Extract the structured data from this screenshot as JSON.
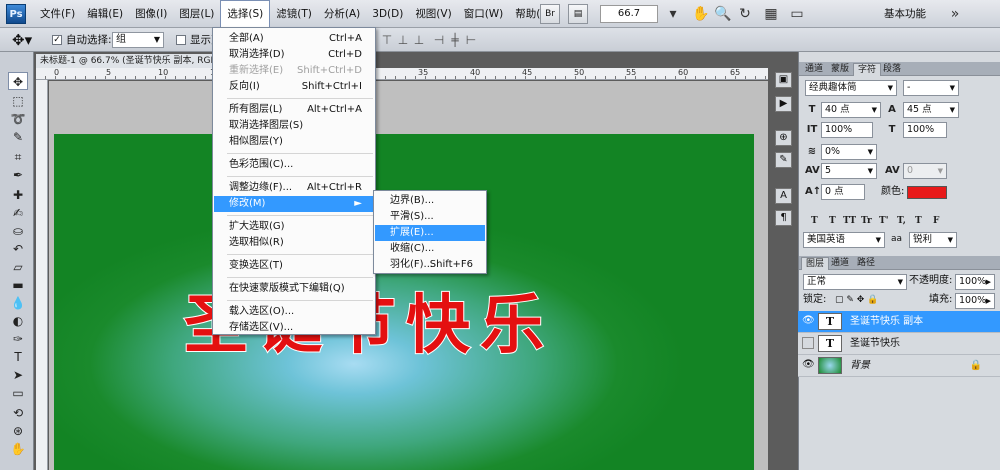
{
  "app": {
    "logo": "Ps"
  },
  "menubar": {
    "items": [
      "文件(F)",
      "编辑(E)",
      "图像(I)",
      "图层(L)",
      "选择(S)",
      "滤镜(T)",
      "分析(A)",
      "3D(D)",
      "视图(V)",
      "窗口(W)",
      "帮助(H)"
    ],
    "active_index": 4,
    "bridge_label": "Br",
    "zoom_value": "66.7",
    "workspace": "基本功能"
  },
  "options_bar": {
    "auto_select_label": "自动选择:",
    "auto_select_checked": true,
    "auto_select_value": "组",
    "show_transform_label": "显示变"
  },
  "document": {
    "tab_title": "未标题-1 @ 66.7% (圣诞节快乐 副本, RGB/8)",
    "ruler_numbers": [
      "0",
      "5",
      "10",
      "15",
      "20",
      "25",
      "30",
      "35",
      "40",
      "45",
      "50",
      "55",
      "60",
      "65"
    ],
    "canvas_text": "圣诞节快乐"
  },
  "select_menu": {
    "items": [
      {
        "label": "全部(A)",
        "shortcut": "Ctrl+A"
      },
      {
        "label": "取消选择(D)",
        "shortcut": "Ctrl+D"
      },
      {
        "label": "重新选择(E)",
        "shortcut": "Shift+Ctrl+D",
        "disabled": true
      },
      {
        "label": "反向(I)",
        "shortcut": "Shift+Ctrl+I"
      },
      {
        "label": "所有图层(L)",
        "shortcut": "Alt+Ctrl+A"
      },
      {
        "label": "取消选择图层(S)",
        "shortcut": ""
      },
      {
        "label": "相似图层(Y)",
        "shortcut": ""
      },
      {
        "label": "色彩范围(C)...",
        "shortcut": ""
      },
      {
        "label": "调整边缘(F)...",
        "shortcut": "Alt+Ctrl+R"
      },
      {
        "label": "修改(M)",
        "shortcut": "",
        "highlighted": true
      },
      {
        "label": "扩大选取(G)",
        "shortcut": ""
      },
      {
        "label": "选取相似(R)",
        "shortcut": ""
      },
      {
        "label": "变换选区(T)",
        "shortcut": ""
      },
      {
        "label": "在快速蒙版模式下编辑(Q)",
        "shortcut": ""
      },
      {
        "label": "载入选区(O)...",
        "shortcut": ""
      },
      {
        "label": "存储选区(V)...",
        "shortcut": ""
      }
    ],
    "submenu_arrow": "►"
  },
  "modify_submenu": {
    "items": [
      {
        "label": "边界(B)...",
        "shortcut": ""
      },
      {
        "label": "平滑(S)...",
        "shortcut": ""
      },
      {
        "label": "扩展(E)...",
        "shortcut": "",
        "highlighted": true
      },
      {
        "label": "收缩(C)...",
        "shortcut": ""
      },
      {
        "label": "羽化(F)...",
        "shortcut": "Shift+F6"
      }
    ]
  },
  "char_panel": {
    "tabs": [
      "通道",
      "蒙版",
      "字符",
      "段落"
    ],
    "active_tab": 2,
    "font_family": "经典趣体简",
    "font_style": "-",
    "font_size": "40 点",
    "leading": "45 点",
    "vertical_scale": "100%",
    "horizontal_scale": "100%",
    "tsume": "0%",
    "tracking": "5",
    "kerning": "0",
    "baseline_shift": "0 点",
    "color_label": "颜色:",
    "text_color": "#e81919",
    "format_buttons": [
      "T",
      "T",
      "TT",
      "Tr",
      "T'",
      "T,",
      "T",
      "F"
    ],
    "language": "美国英语",
    "aa_icon": "aa",
    "antialias": "锐利"
  },
  "layers_panel": {
    "tabs": [
      "图层",
      "通道",
      "路径"
    ],
    "active_tab": 0,
    "blend_mode": "正常",
    "opacity_label": "不透明度:",
    "opacity": "100%",
    "lock_label": "锁定:",
    "fill_label": "填充:",
    "fill": "100%",
    "layers": [
      {
        "name": "圣诞节快乐 副本",
        "type": "text",
        "visible": true,
        "selected": true
      },
      {
        "name": "圣诞节快乐",
        "type": "text",
        "visible": false,
        "selected": false
      },
      {
        "name": "背景",
        "type": "image",
        "visible": true,
        "selected": false,
        "locked": true
      }
    ],
    "text_thumb": "T"
  }
}
